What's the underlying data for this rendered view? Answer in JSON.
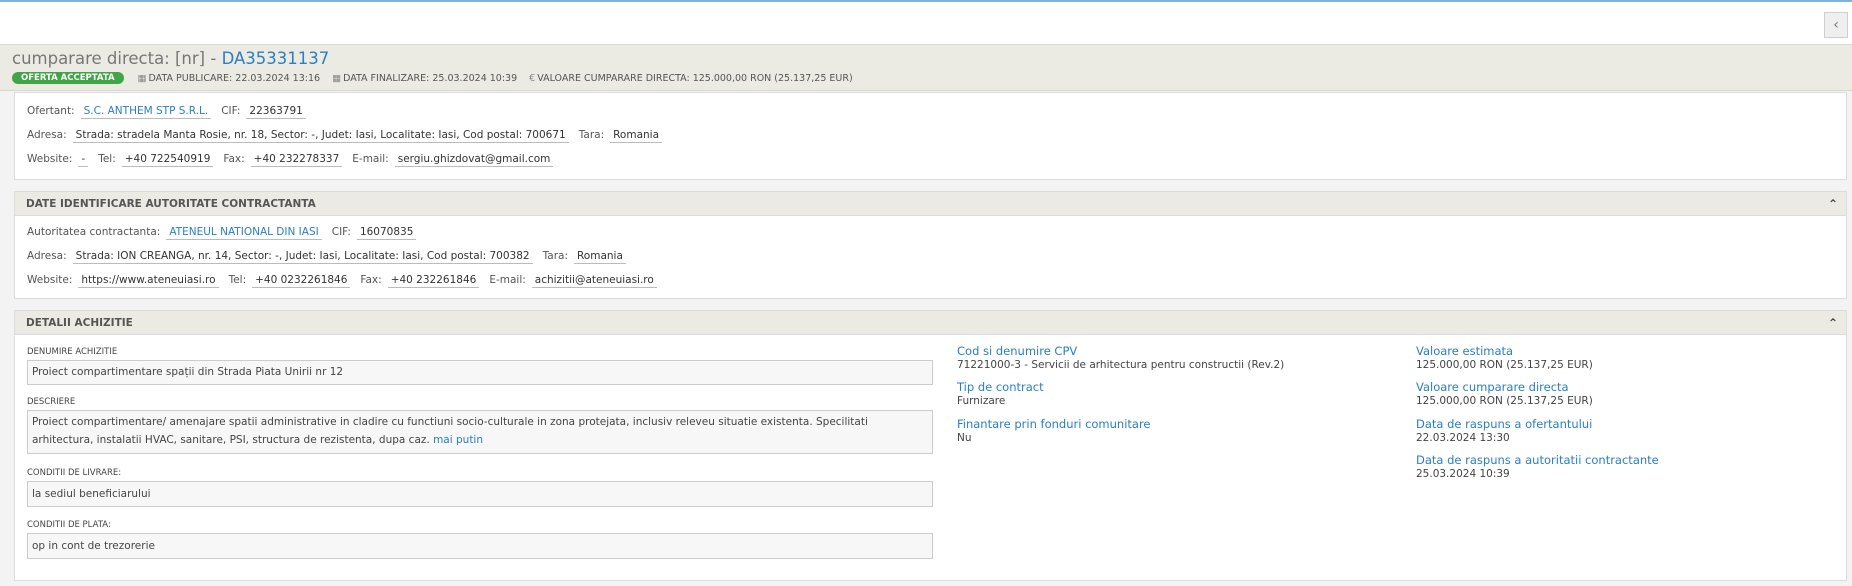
{
  "topbar": {
    "collapse_label": "‹"
  },
  "header": {
    "title_prefix": "cumparare directa: [nr] -",
    "title_code": "DA35331137",
    "status_badge": "OFERTA ACCEPTATA",
    "data_publicare": "DATA PUBLICARE: 22.03.2024 13:16",
    "data_finalizare": "DATA FINALIZARE: 25.03.2024 10:39",
    "valoare": "VALOARE CUMPARARE DIRECTA: 125.000,00  RON (25.137,25  EUR)"
  },
  "ofertant": {
    "ofertant_label": "Ofertant:",
    "ofertant_name": "S.C. ANTHEM STP S.R.L.",
    "cif_label": "CIF:",
    "cif": "22363791",
    "adresa_label": "Adresa:",
    "adresa": "Strada: stradela Manta Rosie, nr. 18, Sector: -, Judet: Iasi, Localitate: Iasi, Cod postal: 700671",
    "tara_label": "Tara:",
    "tara": "Romania",
    "website_label": "Website:",
    "website": "-",
    "tel_label": "Tel:",
    "tel": "+40 722540919",
    "fax_label": "Fax:",
    "fax": "+40 232278337",
    "email_label": "E-mail:",
    "email": "sergiu.ghizdovat@gmail.com"
  },
  "autoritate": {
    "section_title": "DATE IDENTIFICARE AUTORITATE CONTRACTANTA",
    "autoritate_label": "Autoritatea contractanta:",
    "autoritate_name": "ATENEUL NATIONAL DIN IASI",
    "cif_label": "CIF:",
    "cif": "16070835",
    "adresa_label": "Adresa:",
    "adresa": "Strada: ION CREANGA, nr. 14, Sector: -, Judet: Iasi, Localitate: Iasi, Cod postal: 700382",
    "tara_label": "Tara:",
    "tara": "Romania",
    "website_label": "Website:",
    "website": "https://www.ateneuiasi.ro",
    "tel_label": "Tel:",
    "tel": "+40 0232261846",
    "fax_label": "Fax:",
    "fax": "+40 232261846",
    "email_label": "E-mail:",
    "email": "achizitii@ateneuiasi.ro"
  },
  "achizitie": {
    "section_title": "DETALII ACHIZITIE",
    "denumire_label": "DENUMIRE ACHIZITIE",
    "denumire": "Proiect compartimentare spații din Strada Piata Unirii nr 12",
    "descriere_label": "DESCRIERE",
    "descriere": "Proiect compartimentare/ amenajare spatii administrative in cladire cu functiuni socio-culturale in zona protejata, inclusiv releveu situatie existenta. Specilitati arhitectura, instalatii HVAC, sanitare, PSI, structura de rezistenta, dupa caz.",
    "mai_putin": "mai putin",
    "livrare_label": "CONDITII DE LIVRARE:",
    "livrare": "la sediul beneficiarului",
    "plata_label": "CONDITII DE PLATA:",
    "plata": "op in cont de trezorerie",
    "cpv_label": "Cod si denumire CPV",
    "cpv": "71221000-3 - Servicii de arhitectura pentru constructii (Rev.2)",
    "tip_label": "Tip de contract",
    "tip": "Furnizare",
    "finantare_label": "Finantare prin fonduri comunitare",
    "finantare": "Nu",
    "val_estimata_label": "Valoare estimata",
    "val_estimata": "125.000,00  RON (25.137,25  EUR)",
    "val_cumparare_label": "Valoare cumparare directa",
    "val_cumparare": "125.000,00  RON (25.137,25  EUR)",
    "raspuns_ofertant_label": "Data de raspuns a ofertantului",
    "raspuns_ofertant": "22.03.2024 13:30",
    "raspuns_autoritate_label": "Data de raspuns a autoritatii contractante",
    "raspuns_autoritate": "25.03.2024 10:39"
  }
}
